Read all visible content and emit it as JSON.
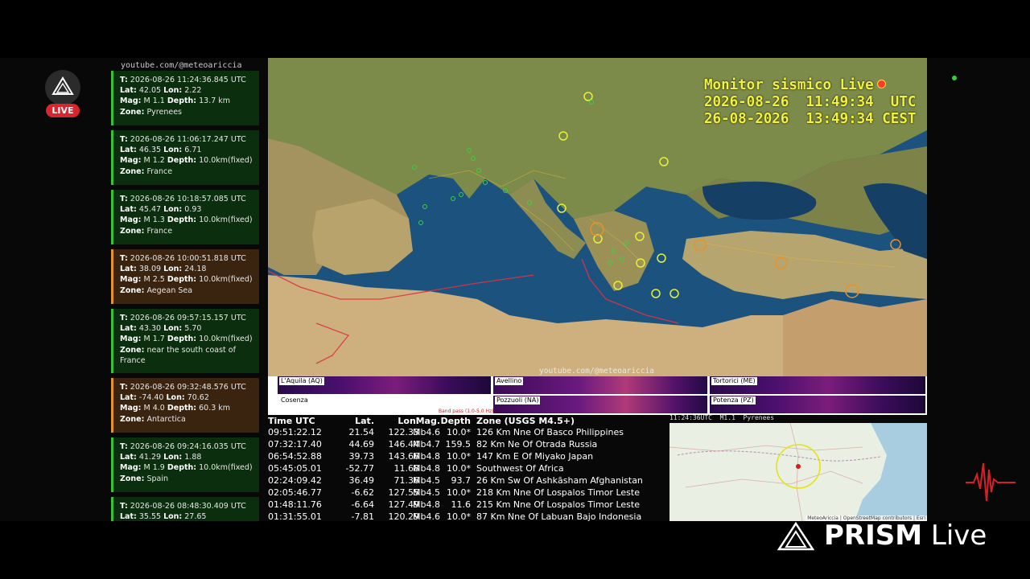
{
  "brand": {
    "handle_top": "youtube.com/@meteoariccia",
    "handle_map": "youtube.com/@meteoariccia",
    "live_label": "LIVE",
    "logo_word": "PRISM",
    "logo_suffix": "Live"
  },
  "monitor": {
    "title": "Monitor sismico Live",
    "utc_line": "2026-08-26  11:49:34  UTC",
    "cest_line": "26-08-2026  13:49:34 CEST"
  },
  "events": [
    {
      "t": "2026-08-26  11:24:36.845 UTC",
      "lat": "42.05",
      "lon": "2.22",
      "mag": "M 1.1",
      "depth": "13.7 km",
      "zone": "Pyrenees",
      "level": "green"
    },
    {
      "t": "2026-08-26  11:06:17.247 UTC",
      "lat": "46.35",
      "lon": "6.71",
      "mag": "M 1.2",
      "depth": "10.0km(fixed)",
      "zone": "France",
      "level": "green"
    },
    {
      "t": "2026-08-26  10:18:57.085 UTC",
      "lat": "45.47",
      "lon": "0.93",
      "mag": "M 1.3",
      "depth": "10.0km(fixed)",
      "zone": "France",
      "level": "green"
    },
    {
      "t": "2026-08-26  10:00:51.818 UTC",
      "lat": "38.09",
      "lon": "24.18",
      "mag": "M 2.5",
      "depth": "10.0km(fixed)",
      "zone": "Aegean Sea",
      "level": "orange"
    },
    {
      "t": "2026-08-26  09:57:15.157 UTC",
      "lat": "43.30",
      "lon": "5.70",
      "mag": "M 1.7",
      "depth": "10.0km(fixed)",
      "zone": "near the south coast of France",
      "level": "green"
    },
    {
      "t": "2026-08-26  09:32:48.576 UTC",
      "lat": "-74.40",
      "lon": "70.62",
      "mag": "M 4.0",
      "depth": "60.3 km",
      "zone": "Antarctica",
      "level": "orange"
    },
    {
      "t": "2026-08-26  09:24:16.035 UTC",
      "lat": "41.29",
      "lon": "1.88",
      "mag": "M 1.9",
      "depth": "10.0km(fixed)",
      "zone": "Spain",
      "level": "green"
    },
    {
      "t": "2026-08-26  08:48:30.409 UTC",
      "lat": "35.55",
      "lon": "27.65",
      "mag": "",
      "depth": "",
      "zone": "",
      "level": "green"
    }
  ],
  "labels": {
    "t": "T:",
    "lat": "Lat:",
    "lon": "Lon:",
    "mag": "Mag:",
    "depth": "Depth:",
    "zone": "Zone:"
  },
  "stations": [
    "L'Aquila (AQ)",
    "Avellino",
    "Tortorici (ME)",
    "Cosenza",
    "Pozzuoli (NA)",
    "Potenza (PZ)"
  ],
  "spectro_note": "Band pass (1.0-5.0 Hz)",
  "usgs": {
    "headers": [
      "Time UTC",
      "Lat.",
      "Lon.",
      "Mag.",
      "Depth",
      "Zone (USGS M4.5+)"
    ],
    "rows": [
      [
        "09:51:22.12",
        "21.54",
        "122.33",
        "Mb4.6",
        "10.0*",
        "126 Km Nne Of Basco Philippines"
      ],
      [
        "07:32:17.40",
        "44.69",
        "146.44",
        "Mb4.7",
        "159.5",
        "82 Km Ne Of Otrada Russia"
      ],
      [
        "06:54:52.88",
        "39.73",
        "143.66",
        "Mb4.8",
        "10.0*",
        "147 Km E Of Miyako Japan"
      ],
      [
        "05:45:05.01",
        "-52.77",
        "11.68",
        "Mb4.8",
        "10.0*",
        "Southwest Of Africa"
      ],
      [
        "02:24:09.42",
        "36.49",
        "71.36",
        "Mb4.5",
        "93.7",
        "26 Km Sw Of Ashkāsham Afghanistan"
      ],
      [
        "02:05:46.77",
        "-6.62",
        "127.55",
        "Mb4.5",
        "10.0*",
        "218 Km Nne Of Lospalos Timor Leste"
      ],
      [
        "01:48:11.76",
        "-6.64",
        "127.49",
        "Mb4.8",
        "11.6",
        "215 Km Nne Of Lospalos Timor Leste"
      ],
      [
        "01:31:55.01",
        "-7.81",
        "120.29",
        "Mb4.6",
        "10.0*",
        "87 Km Nne Of Labuan Bajo Indonesia"
      ]
    ]
  },
  "mini_map": {
    "header": "11:24:36UTC  M1.1  Pyrenees",
    "credit": "MeteoAriccia | OpenStreetMap contributors | Esri"
  },
  "colors": {
    "map_sea": "#1b4f7a",
    "land": "#b59e6a",
    "title": "#f1f23a",
    "live": "#d7262e",
    "green_card": "#0b2e0e",
    "orange_card": "#3a2410"
  }
}
